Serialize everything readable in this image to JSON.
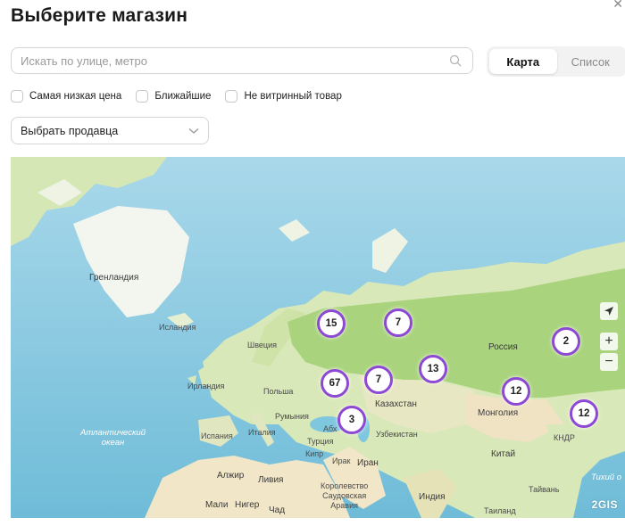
{
  "header": {
    "title": "Выберите магазин",
    "close_icon": "close-icon"
  },
  "search": {
    "placeholder": "Искать по улице, метро",
    "value": "",
    "icon": "search-icon"
  },
  "view_toggle": {
    "options": [
      "Карта",
      "Список"
    ],
    "selected": "Карта"
  },
  "filters": [
    {
      "label": "Самая низкая цена",
      "checked": false
    },
    {
      "label": "Ближайшие",
      "checked": false
    },
    {
      "label": "Не витринный товар",
      "checked": false
    }
  ],
  "seller_select": {
    "placeholder": "Выбрать продавца",
    "icon": "chevron-down-icon"
  },
  "map": {
    "labels": {
      "greenland": "Гренландия",
      "iceland": "Исландия",
      "sweden": "Швеция",
      "ireland": "Ирландия",
      "poland": "Польша",
      "romania": "Румыния",
      "spain": "Испания",
      "italy": "Италия",
      "turkey": "Турция",
      "cyprus": "Кипр",
      "iraq": "Ирак",
      "iran": "Иран",
      "abkhazia": "Абх",
      "kazakhstan": "Казахстан",
      "uzbekistan": "Узбекистан",
      "russia": "Россия",
      "mongolia": "Монголия",
      "china": "Китай",
      "dprk": "КНДР",
      "taiwan": "Тайвань",
      "thailand": "Таиланд",
      "india": "Индия",
      "algeria": "Алжир",
      "libya": "Ливия",
      "mali": "Мали",
      "niger": "Нигер",
      "chad": "Чад",
      "saudi": "Королевство\nСаудовская\nАравия",
      "atlantic": "Атлантический\nокеан",
      "pacific": "Тихий о"
    },
    "clusters": [
      {
        "count": "15"
      },
      {
        "count": "7"
      },
      {
        "count": "2"
      },
      {
        "count": "67"
      },
      {
        "count": "7"
      },
      {
        "count": "13"
      },
      {
        "count": "12"
      },
      {
        "count": "12"
      },
      {
        "count": "3"
      }
    ],
    "controls": {
      "locate_icon": "navigation-arrow-icon",
      "zoom_in": "+",
      "zoom_out": "−"
    },
    "brand": "2GIS"
  },
  "colors": {
    "accent": "#8d48d4",
    "ocean": "#7fc7df",
    "land": "#d9e8b8",
    "forest": "#a9d37d",
    "desert": "#efe3c4"
  }
}
